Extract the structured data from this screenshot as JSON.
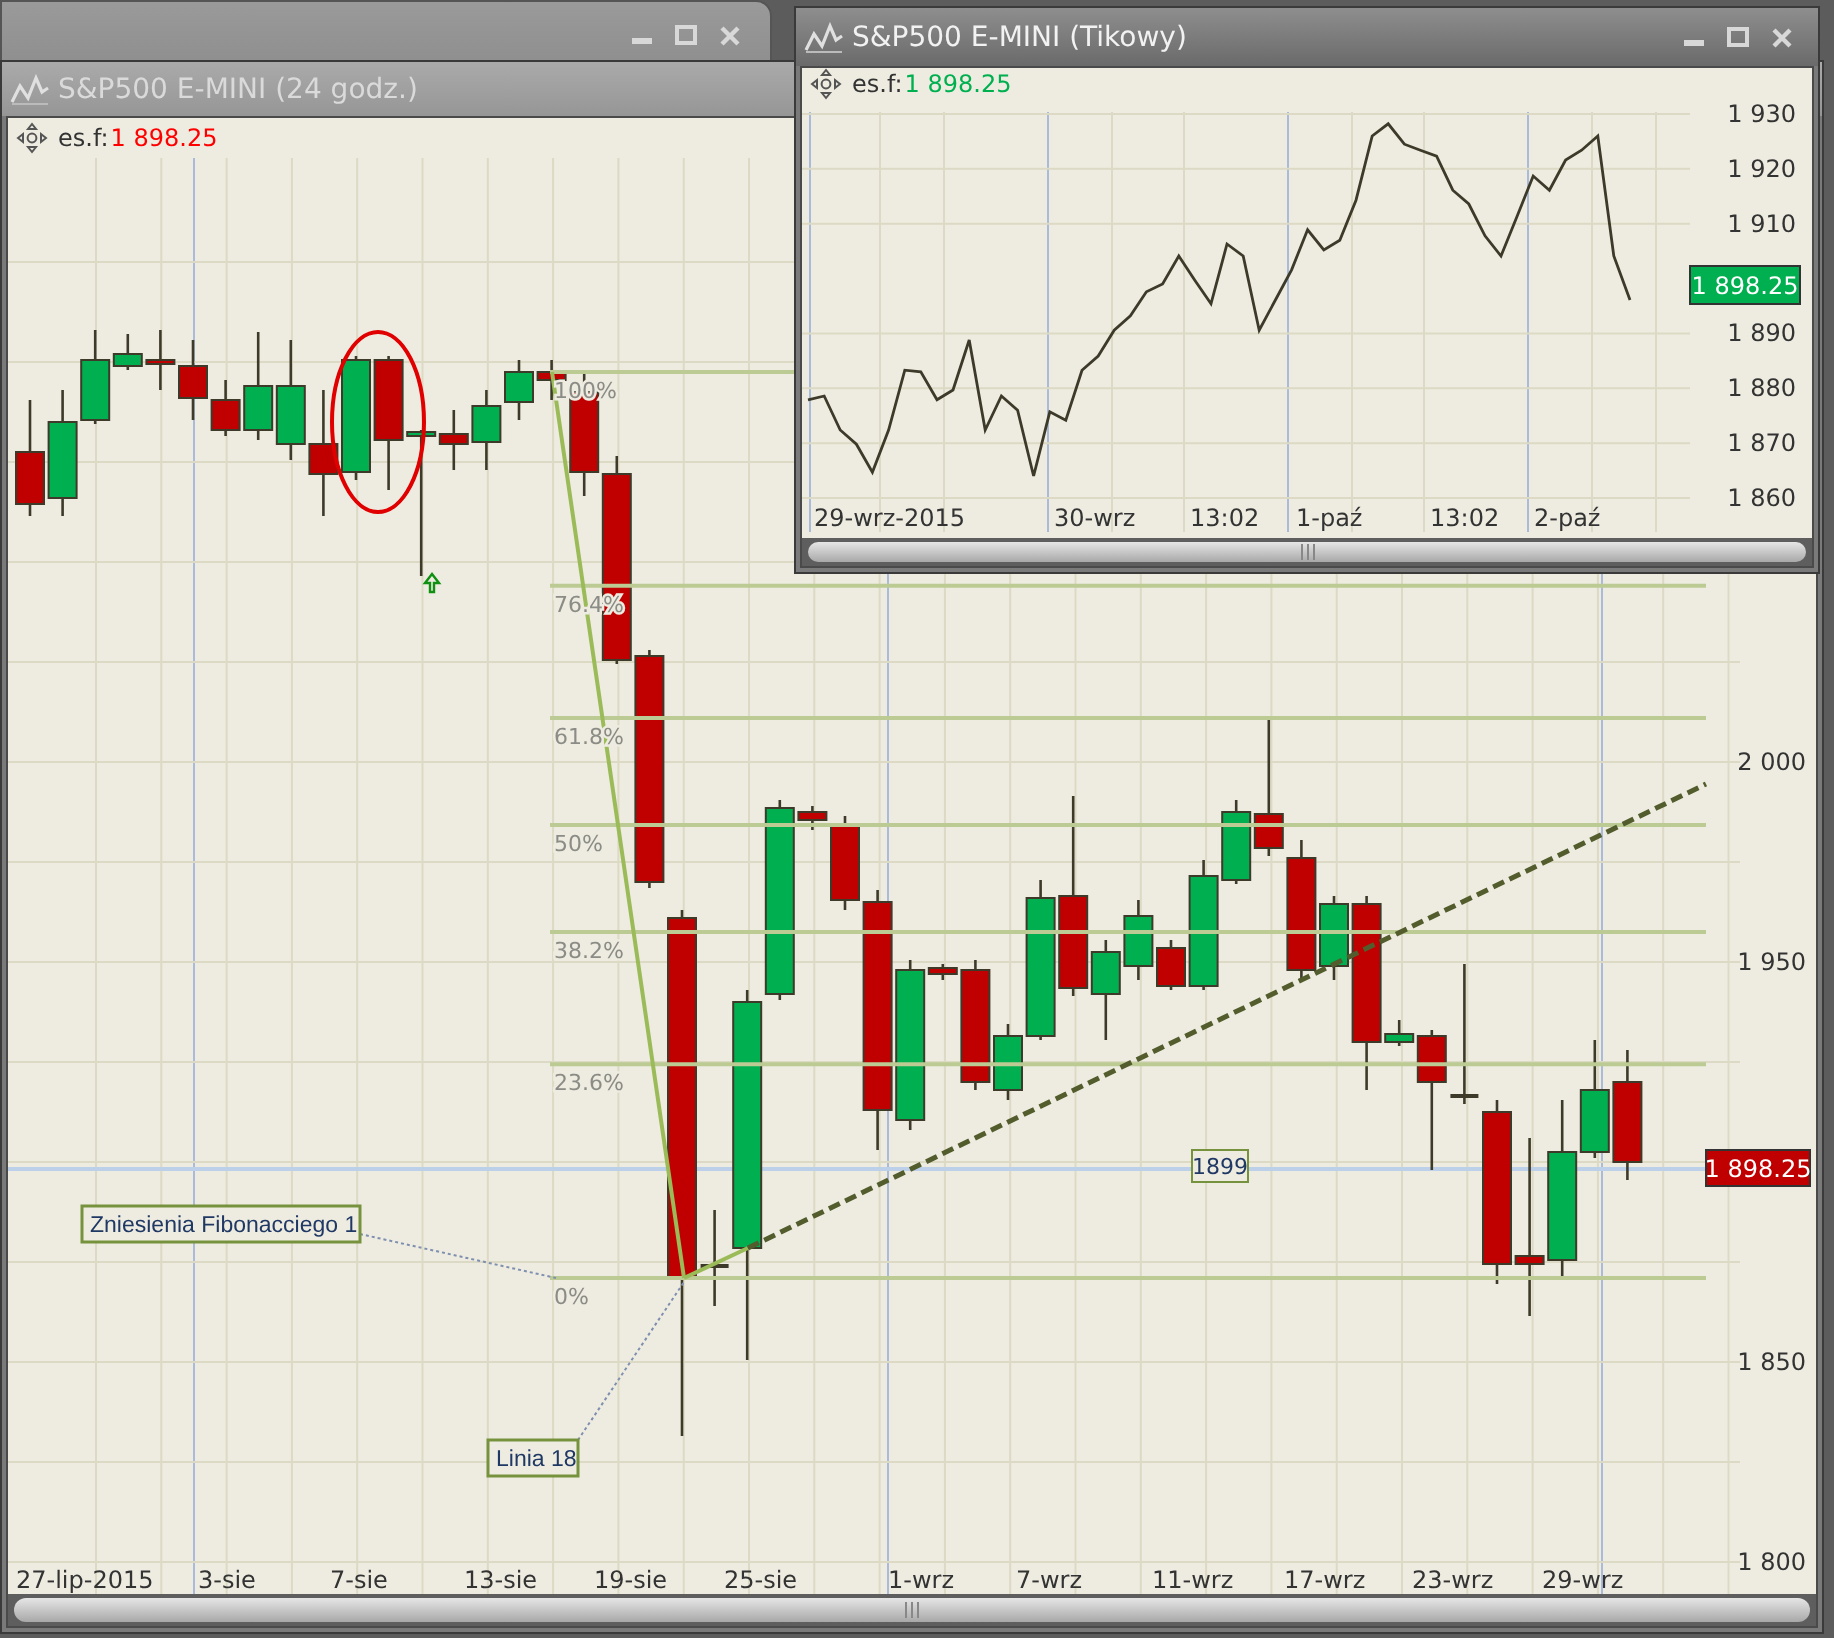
{
  "windows": [
    {
      "kind": "candle",
      "title": "S&P500 E-MINI (24 godz.)",
      "legend": {
        "symbol": "es.f:",
        "value": "1 898.25",
        "color": "#ff0000"
      },
      "price_tag": {
        "text": "1 898.25",
        "color": "#c00000"
      },
      "line_value": "1899",
      "x_labels": [
        "27-lip-2015",
        "3-sie",
        "7-sie",
        "13-sie",
        "19-sie",
        "25-sie",
        "1-wrz",
        "7-wrz",
        "11-wrz",
        "17-wrz",
        "23-wrz",
        "29-wrz"
      ],
      "fibonacci_levels": [
        "100%",
        "76.4%",
        "61.8%",
        "50%",
        "38.2%",
        "23.6%",
        "0%"
      ],
      "annotations": [
        "Zniesienia Fibonacciego 1",
        "Linia 18"
      ],
      "chart_data": {
        "type": "candlestick",
        "yticks": [
          {
            "value": 2000,
            "label": "2 000"
          },
          {
            "value": 1950,
            "label": "1 950"
          },
          {
            "value": 1850,
            "label": "1 850"
          },
          {
            "value": 1800,
            "label": "1 800"
          }
        ],
        "ylim": [
          1792,
          2151
        ],
        "grid": true,
        "ref_lines": [
          {
            "axis": "y",
            "value": 1898.25
          }
        ],
        "categories": [
          null,
          null,
          null,
          null,
          null,
          null,
          null,
          null,
          null,
          null,
          null,
          null,
          null,
          null,
          null,
          null,
          null,
          null,
          null,
          null,
          null,
          null,
          null,
          null,
          null,
          null,
          null,
          null,
          null,
          null,
          null,
          null,
          null,
          null,
          null,
          null,
          null,
          null,
          null,
          null,
          null,
          null,
          null,
          null,
          null,
          null,
          null,
          null,
          null,
          null
        ],
        "ohlc": [
          [
            2077.5,
            2090.5,
            2061.5,
            2064.5
          ],
          [
            2066,
            2093,
            2061.5,
            2085
          ],
          [
            2085.5,
            2108,
            2084.5,
            2100.5
          ],
          [
            2099,
            2107,
            2098,
            2102
          ],
          [
            2100.5,
            2108,
            2093,
            2099.5
          ],
          [
            2099,
            2105.5,
            2085.5,
            2091
          ],
          [
            2090.5,
            2095.5,
            2081.5,
            2083
          ],
          [
            2083,
            2107.5,
            2080.5,
            2094
          ],
          [
            2079.5,
            2105.5,
            2075.5,
            2094
          ],
          [
            2079.5,
            2093,
            2061.5,
            2072
          ],
          [
            2072.5,
            2101.5,
            2070.5,
            2100.5
          ],
          [
            2100.5,
            2101.5,
            2068,
            2080.5
          ],
          [
            2081.5,
            2083,
            2046.5,
            2082.5
          ],
          [
            2082,
            2088,
            2073,
            2079.5
          ],
          [
            2080,
            2093,
            2073,
            2089
          ],
          [
            2090,
            2100.5,
            2085.5,
            2097.5
          ],
          [
            2097.5,
            2100.5,
            2090.5,
            2095.5
          ],
          [
            2092.5,
            2097.5,
            2066.5,
            2072.5
          ],
          [
            2072,
            2076.5,
            2024.5,
            2025.5
          ],
          [
            2026.5,
            2028,
            1968.5,
            1970
          ],
          [
            1961,
            1963,
            1831.5,
            1871
          ],
          [
            1874,
            1888,
            1864,
            1874
          ],
          [
            1878.5,
            1943,
            1850.5,
            1940
          ],
          [
            1942,
            1990.5,
            1940.5,
            1988.5
          ],
          [
            1987.5,
            1989,
            1983,
            1985.5
          ],
          [
            1984.5,
            1986.5,
            1963,
            1965.5
          ],
          [
            1965,
            1968,
            1903,
            1913
          ],
          [
            1910.5,
            1950.5,
            1908,
            1948
          ],
          [
            1948.5,
            1949.5,
            1945.5,
            1947
          ],
          [
            1948,
            1950.5,
            1918,
            1920
          ],
          [
            1918,
            1934.5,
            1915.5,
            1931.5
          ],
          [
            1931.5,
            1970.5,
            1930.5,
            1966
          ],
          [
            1966.5,
            1991.5,
            1941.5,
            1943.5
          ],
          [
            1942,
            1955.5,
            1930.5,
            1952.5
          ],
          [
            1949,
            1965.5,
            1945.5,
            1961.5
          ],
          [
            1953.5,
            1955.5,
            1943,
            1944
          ],
          [
            1944,
            1975.5,
            1943,
            1971.5
          ],
          [
            1970.5,
            1990.5,
            1969.5,
            1987.5
          ],
          [
            1987,
            2011.5,
            1976.5,
            1978.5
          ],
          [
            1976,
            1980.5,
            1945.5,
            1948
          ],
          [
            1949,
            1966.5,
            1945.5,
            1964.5
          ],
          [
            1964.5,
            1966.5,
            1918,
            1930
          ],
          [
            1930,
            1935.5,
            1929,
            1932
          ],
          [
            1931.5,
            1933,
            1898,
            1920
          ],
          [
            1916.5,
            1949.5,
            1914.5,
            1916.5
          ],
          [
            1912.5,
            1915.5,
            1869.5,
            1874.5
          ],
          [
            1876.5,
            1906,
            1861.5,
            1874.5
          ],
          [
            1875.5,
            1915.5,
            1871.5,
            1902.5
          ],
          [
            1902.5,
            1930.5,
            1901,
            1918
          ],
          [
            1920,
            1928,
            1895.5,
            1900
          ]
        ]
      }
    },
    {
      "kind": "tick",
      "title": "S&P500 E-MINI (Tikowy)",
      "legend": {
        "symbol": "es.f:",
        "value": "1 898.25",
        "color": "#00b050"
      },
      "price_tag": {
        "text": "1 898.25",
        "color": "#00b050"
      },
      "x_labels": [
        "29-wrz-2015",
        "30-wrz",
        "13:02",
        "1-paź",
        "13:02",
        "2-paź"
      ],
      "chart_data": {
        "type": "line",
        "ylim": [
          1860,
          1930
        ],
        "grid": true,
        "yticks": [
          {
            "value": 1930,
            "label": "1 930"
          },
          {
            "value": 1920,
            "label": "1 920"
          },
          {
            "value": 1910,
            "label": "1 910"
          },
          {
            "value": 1890,
            "label": "1 890"
          },
          {
            "value": 1880,
            "label": "1 880"
          },
          {
            "value": 1870,
            "label": "1 870"
          },
          {
            "value": 1860,
            "label": "1 860"
          }
        ],
        "series": [
          {
            "color": "#3d3a2a",
            "values": [
              1877.9,
              1878.6,
              1872.4,
              1869.8,
              1864.7,
              1872.4,
              1883.3,
              1883,
              1877.9,
              1879.7,
              1888.8,
              1872.4,
              1878.6,
              1876,
              1864,
              1875.7,
              1874.2,
              1883.3,
              1885.9,
              1890.6,
              1893.2,
              1897.6,
              1899,
              1904.1,
              1899.7,
              1895.4,
              1906.3,
              1904.1,
              1890.6,
              1896.1,
              1901.6,
              1908.9,
              1905.2,
              1907,
              1914.3,
              1926,
              1928.2,
              1924.5,
              1923.4,
              1922.3,
              1916.1,
              1913.6,
              1907.8,
              1904.1,
              1911.4,
              1918.7,
              1916.1,
              1921.6,
              1923.4,
              1926,
              1904.1,
              1896.1
            ]
          }
        ]
      }
    }
  ]
}
